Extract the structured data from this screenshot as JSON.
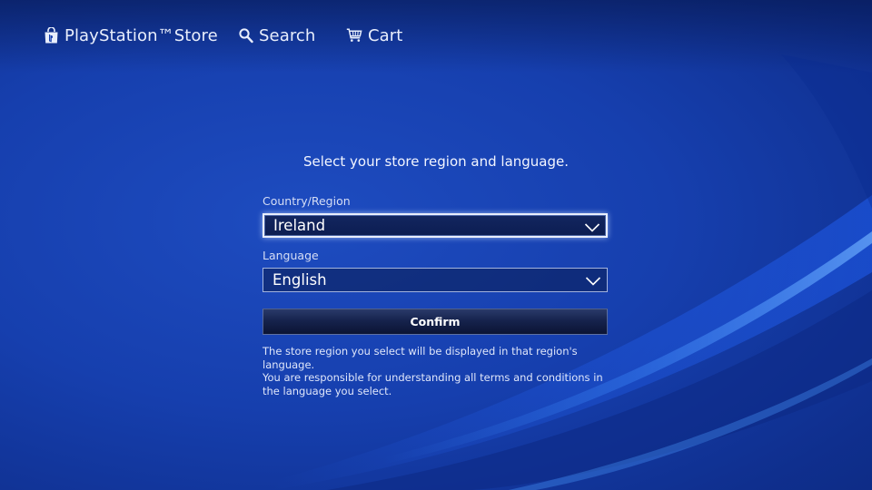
{
  "nav": {
    "store_label": "PlayStation™Store",
    "search_label": "Search",
    "cart_label": "Cart"
  },
  "icons": {
    "store": "shopping-bag-icon",
    "search": "search-icon",
    "cart": "cart-icon",
    "dropdown": "chevron-down-icon"
  },
  "form": {
    "heading": "Select your store region and language.",
    "country_label": "Country/Region",
    "country_value": "Ireland",
    "language_label": "Language",
    "language_value": "English",
    "confirm_label": "Confirm",
    "note_line1": "The store region you select will be displayed in that region's language.",
    "note_line2": "You are responsible for understanding all terms and conditions in the language you select."
  },
  "colors": {
    "background": "#163fae",
    "text": "#ffffff",
    "button": "#16234d"
  }
}
